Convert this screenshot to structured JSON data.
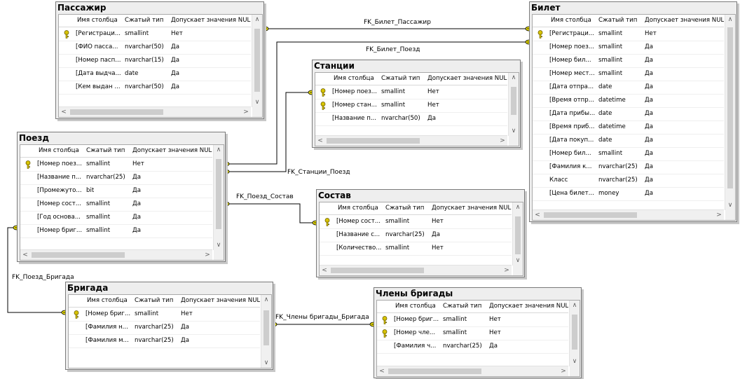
{
  "diagram": {
    "header_labels": {
      "name": "Имя столбца",
      "type": "Сжатый тип",
      "null": "Допускает значения NULL"
    },
    "tables": [
      {
        "name": "Пассажир",
        "columns": [
          {
            "key": true,
            "name": "[Регистраци...",
            "type": "smallint",
            "nullable": "Нет"
          },
          {
            "key": false,
            "name": "[ФИО пасса...",
            "type": "nvarchar(50)",
            "nullable": "Да"
          },
          {
            "key": false,
            "name": "[Номер пасп...",
            "type": "nvarchar(15)",
            "nullable": "Да"
          },
          {
            "key": false,
            "name": "[Дата выдча...",
            "type": "date",
            "nullable": "Да"
          },
          {
            "key": false,
            "name": "[Кем выдан ...",
            "type": "nvarchar(50)",
            "nullable": "Да"
          }
        ]
      },
      {
        "name": "Билет",
        "columns": [
          {
            "key": true,
            "name": "[Регистраци...",
            "type": "smallint",
            "nullable": "Нет"
          },
          {
            "key": false,
            "name": "[Номер поез...",
            "type": "smallint",
            "nullable": "Да"
          },
          {
            "key": false,
            "name": "[Номер бил...",
            "type": "smallint",
            "nullable": "Да"
          },
          {
            "key": false,
            "name": "[Номер мест...",
            "type": "smallint",
            "nullable": "Да"
          },
          {
            "key": false,
            "name": "[Дата отпра...",
            "type": "date",
            "nullable": "Да"
          },
          {
            "key": false,
            "name": "[Время отпр...",
            "type": "datetime",
            "nullable": "Да"
          },
          {
            "key": false,
            "name": "[Дата прибы...",
            "type": "date",
            "nullable": "Да"
          },
          {
            "key": false,
            "name": "[Время приб...",
            "type": "datetime",
            "nullable": "Да"
          },
          {
            "key": false,
            "name": "[Дата покуп...",
            "type": "date",
            "nullable": "Да"
          },
          {
            "key": false,
            "name": "[Номер бил...",
            "type": "smallint",
            "nullable": "Да"
          },
          {
            "key": false,
            "name": "[Фамилия к...",
            "type": "nvarchar(25)",
            "nullable": "Да"
          },
          {
            "key": false,
            "name": "Класс",
            "type": "nvarchar(25)",
            "nullable": "Да"
          },
          {
            "key": false,
            "name": "[Цена билет...",
            "type": "money",
            "nullable": "Да"
          }
        ]
      },
      {
        "name": "Станции",
        "columns": [
          {
            "key": true,
            "name": "[Номер поез...",
            "type": "smallint",
            "nullable": "Нет"
          },
          {
            "key": true,
            "name": "[Номер стан...",
            "type": "smallint",
            "nullable": "Нет"
          },
          {
            "key": false,
            "name": "[Название п...",
            "type": "nvarchar(50)",
            "nullable": "Да"
          }
        ]
      },
      {
        "name": "Поезд",
        "columns": [
          {
            "key": true,
            "name": "[Номер поез...",
            "type": "smallint",
            "nullable": "Нет"
          },
          {
            "key": false,
            "name": "[Название п...",
            "type": "nvarchar(25)",
            "nullable": "Да"
          },
          {
            "key": false,
            "name": "[Промежуто...",
            "type": "bit",
            "nullable": "Да"
          },
          {
            "key": false,
            "name": "[Номер сост...",
            "type": "smallint",
            "nullable": "Да"
          },
          {
            "key": false,
            "name": "[Год основа...",
            "type": "smallint",
            "nullable": "Да"
          },
          {
            "key": false,
            "name": "[Номер бриг...",
            "type": "smallint",
            "nullable": "Да"
          }
        ]
      },
      {
        "name": "Состав",
        "columns": [
          {
            "key": true,
            "name": "[Номер сост...",
            "type": "smallint",
            "nullable": "Нет"
          },
          {
            "key": false,
            "name": "[Название с...",
            "type": "nvarchar(25)",
            "nullable": "Да"
          },
          {
            "key": false,
            "name": "[Количество...",
            "type": "smallint",
            "nullable": "Нет"
          }
        ]
      },
      {
        "name": "Бригада",
        "columns": [
          {
            "key": true,
            "name": "[Номер бриг...",
            "type": "smallint",
            "nullable": "Нет"
          },
          {
            "key": false,
            "name": "[Фамилия н...",
            "type": "nvarchar(25)",
            "nullable": "Да"
          },
          {
            "key": false,
            "name": "[Фамилия м...",
            "type": "nvarchar(25)",
            "nullable": "Да"
          }
        ]
      },
      {
        "name": "Члены бригады",
        "columns": [
          {
            "key": true,
            "name": "[Номер бриг...",
            "type": "smallint",
            "nullable": "Нет"
          },
          {
            "key": true,
            "name": "[Номер чле...",
            "type": "smallint",
            "nullable": "Нет"
          },
          {
            "key": false,
            "name": "[Фамилия ч...",
            "type": "nvarchar(25)",
            "nullable": "Да"
          }
        ]
      }
    ],
    "relationships": [
      "FK_Билет_Пассажир",
      "FK_Билет_Поезд",
      "FK_Станции_Поезд",
      "FK_Поезд_Состав",
      "FK_Поезд_Бригада",
      "FK_Члены бригады_Бригада"
    ],
    "colors": {
      "line": "#000000",
      "connector": "#f2e600",
      "key": "#d8c400",
      "window": "#eeeeee"
    }
  }
}
